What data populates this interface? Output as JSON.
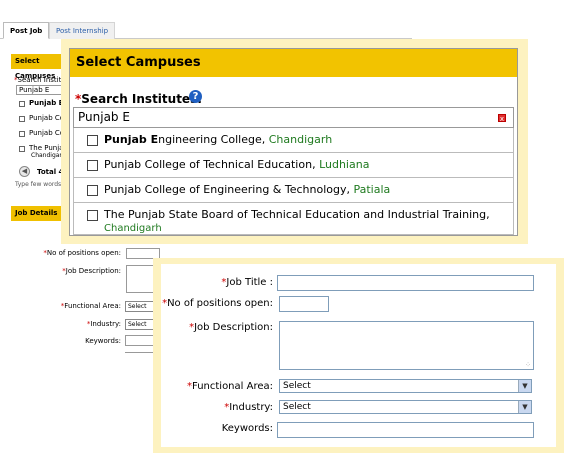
{
  "tabs": {
    "post_job": "Post Job",
    "post_internship": "Post Internship"
  },
  "background_form": {
    "select_campuses_bar": "Select Campuses",
    "search_label": "Search Institutes",
    "search_value": "Punjab E",
    "rows": [
      "Punjab Engineering College",
      "Punjab College of Technical Education",
      "Punjab College of Engineering",
      "The Punjab State Board",
      "Chandigarh"
    ],
    "total_label": "Total 4",
    "hint": "Type few words",
    "job_details_bar": "Job Details",
    "positions_label": "No of positions open:",
    "description_label": "Job Description:",
    "functional_area_label": "Functional Area:",
    "functional_area_value": "Select",
    "industry_label": "Industry:",
    "industry_value": "Select",
    "keywords_label": "Keywords:"
  },
  "select_campuses": {
    "title": "Select Campuses",
    "search_label": "Search Institutes:",
    "search_value": "Punjab E",
    "results": [
      {
        "bold": "Punjab E",
        "name": "ngineering College, ",
        "city": "Chandigarh"
      },
      {
        "bold": "",
        "name": "Punjab College of Technical Education, ",
        "city": "Ludhiana"
      },
      {
        "bold": "",
        "name": "Punjab College of Engineering & Technology, ",
        "city": "Patiala"
      },
      {
        "bold": "",
        "name": "The Punjab State Board of Technical Education and Industrial Training,",
        "city": "Chandigarh"
      }
    ]
  },
  "job_details": {
    "job_title_label": "Job Title :",
    "positions_label": "No of positions open:",
    "description_label": "Job Description:",
    "functional_area_label": "Functional Area:",
    "functional_area_value": "Select",
    "industry_label": "Industry:",
    "industry_value": "Select",
    "keywords_label": "Keywords:"
  },
  "colors": {
    "accent_yellow": "#f2c300",
    "callout_bg": "#fdf2c0",
    "required": "#cc0000",
    "city_green": "#1f7a1f",
    "help_blue": "#1f5fc1"
  },
  "icons": [
    "help-icon",
    "clear-icon",
    "chevron-down-icon",
    "left-arrow-icon"
  ]
}
